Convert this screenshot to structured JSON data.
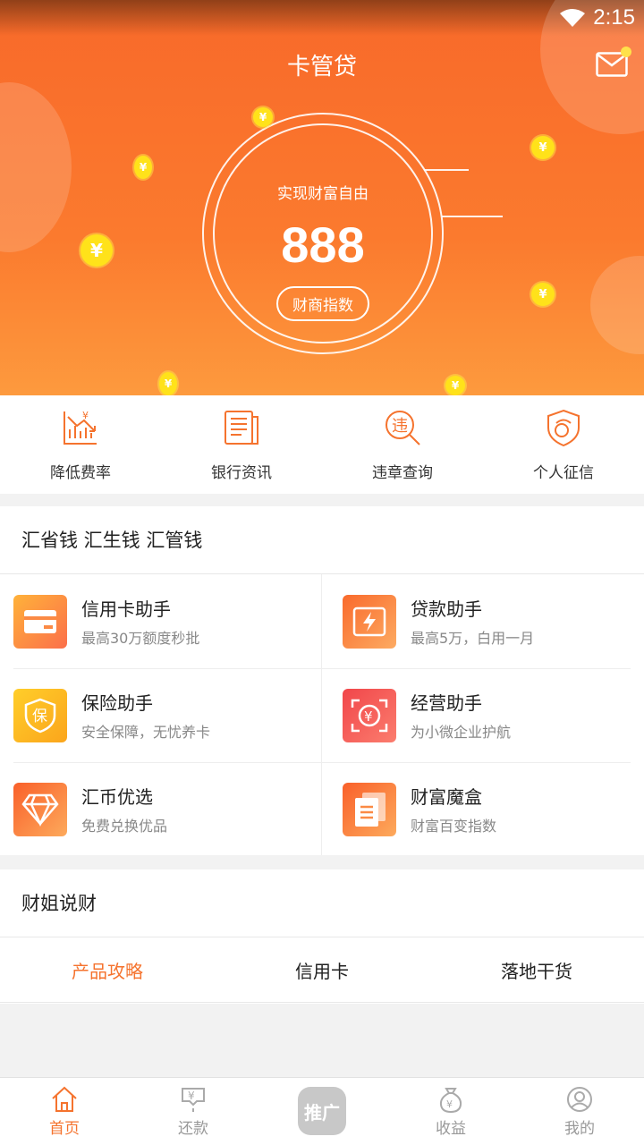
{
  "status": {
    "time": "2:15"
  },
  "header": {
    "title": "卡管贷"
  },
  "score_ring": {
    "subtitle": "实现财富自由",
    "score": "888",
    "button_label": "财商指数"
  },
  "quick_actions": [
    {
      "label": "降低费率",
      "icon": "rate-down-icon"
    },
    {
      "label": "银行资讯",
      "icon": "bank-news-icon"
    },
    {
      "label": "违章查询",
      "icon": "violation-search-icon"
    },
    {
      "label": "个人征信",
      "icon": "credit-shield-icon"
    }
  ],
  "services": {
    "title": "汇省钱 汇生钱 汇管钱",
    "items": [
      {
        "title": "信用卡助手",
        "desc": "最高30万额度秒批",
        "icon": "credit-card-icon"
      },
      {
        "title": "贷款助手",
        "desc": "最高5万，白用一月",
        "icon": "lightning-icon"
      },
      {
        "title": "保险助手",
        "desc": "安全保障，无忧养卡",
        "icon": "insurance-icon",
        "glyph": "保"
      },
      {
        "title": "经营助手",
        "desc": "为小微企业护航",
        "icon": "yuan-scan-icon",
        "glyph": "¥"
      },
      {
        "title": "汇币优选",
        "desc": "免费兑换优品",
        "icon": "diamond-icon"
      },
      {
        "title": "财富魔盒",
        "desc": "财富百变指数",
        "icon": "document-stack-icon"
      }
    ]
  },
  "news": {
    "title": "财姐说财",
    "tabs": [
      {
        "label": "产品攻略",
        "active": true
      },
      {
        "label": "信用卡",
        "active": false
      },
      {
        "label": "落地干货",
        "active": false
      }
    ]
  },
  "bottom_nav": [
    {
      "label": "首页",
      "icon": "home-icon",
      "active": true
    },
    {
      "label": "还款",
      "icon": "repay-icon",
      "active": false
    },
    {
      "label": "推广",
      "icon": "promote-icon",
      "active": false
    },
    {
      "label": "收益",
      "icon": "money-bag-icon",
      "active": false
    },
    {
      "label": "我的",
      "icon": "user-icon",
      "active": false
    }
  ],
  "colors": {
    "accent": "#f5732e",
    "hero_top": "#f8692a",
    "hero_bottom": "#fd9a3e",
    "coin": "#ffe21a"
  }
}
